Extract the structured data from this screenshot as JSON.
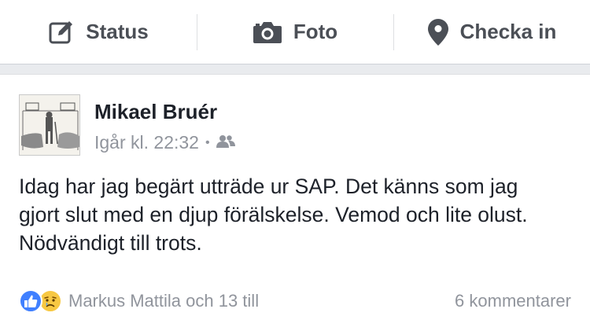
{
  "composer": {
    "actions": [
      {
        "label": "Status",
        "icon": "compose-icon"
      },
      {
        "label": "Foto",
        "icon": "camera-icon"
      },
      {
        "label": "Checka in",
        "icon": "location-pin-icon"
      }
    ]
  },
  "post": {
    "author": "Mikael Bruér",
    "timestamp": "Igår kl. 22:32",
    "separator": "•",
    "privacy_icon": "friends-icon",
    "text": "Idag har jag begärt utträde ur SAP. Det känns som jag gjort slut med en djup förälskelse. Vemod och lite olust. Nödvändigt till trots.",
    "reactions": {
      "icons": [
        "like-icon",
        "sad-icon"
      ],
      "summary": "Markus Mattila och 13 till"
    },
    "comments": "6 kommentarer"
  },
  "colors": {
    "page_bg": "#e9ebee",
    "text": "#1d2129",
    "muted": "#90949c",
    "action_text": "#4b4f56",
    "like_blue": "#4080ff",
    "sad_yellow": "#f7c843"
  }
}
